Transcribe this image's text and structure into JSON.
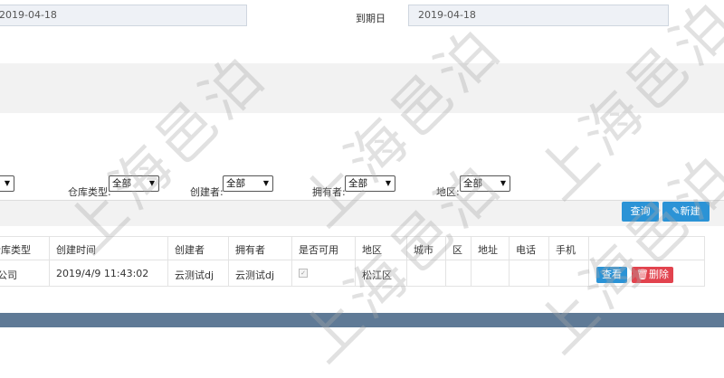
{
  "top": {
    "from_date_value": "2019-04-18",
    "to_date_label": "到期日",
    "to_date_value": "2019-04-18"
  },
  "filters": {
    "first_select_value": "",
    "warehouse_type_label": "仓库类型:",
    "warehouse_type_value": "全部",
    "creator_label": "创建者:",
    "creator_value": "全部",
    "owner_label": "拥有者:",
    "owner_value": "全部",
    "region_label": "地区:",
    "region_value": "全部"
  },
  "toolbar": {
    "query_label": "查询",
    "new_label": "新建"
  },
  "table": {
    "headers": [
      "仓库类型",
      "创建时间",
      "创建者",
      "拥有者",
      "是否可用",
      "地区",
      "城市",
      "区",
      "地址",
      "电话",
      "手机"
    ],
    "row": {
      "type": "分公司",
      "created": "2019/4/9 11:43:02",
      "creator": "云测试dj",
      "owner": "云测试dj",
      "region": "松江区",
      "view_label": "查看",
      "delete_label": "删除"
    }
  },
  "watermark": {
    "text": "上海邑泊"
  },
  "colors": {
    "accent": "#2b93d6",
    "danger": "#e2434e",
    "footer": "#5f7a96"
  }
}
